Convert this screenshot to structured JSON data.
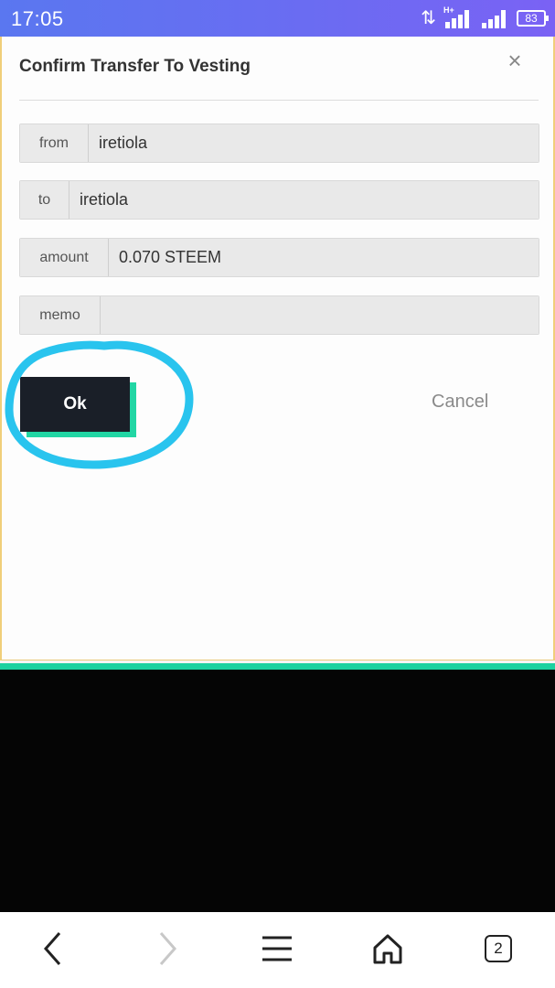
{
  "status_bar": {
    "time": "17:05",
    "network_label": "H+",
    "battery_level": "83",
    "icons": [
      "data-arrows-icon",
      "signal-bars-icon",
      "signal-bars-icon",
      "battery-icon"
    ]
  },
  "dialog": {
    "title": "Confirm Transfer To Vesting",
    "close_icon": "close-icon",
    "fields": [
      {
        "label": "from",
        "value": "iretiola",
        "placeholder": ""
      },
      {
        "label": "to",
        "value": "iretiola",
        "placeholder": ""
      },
      {
        "label": "amount",
        "value": "0.070 STEEM",
        "placeholder": ""
      },
      {
        "label": "memo",
        "value": "",
        "placeholder": ""
      }
    ],
    "ok_label": "Ok",
    "cancel_label": "Cancel"
  },
  "colors": {
    "status_bar": "#6a6cf2",
    "ok_button": "#1a1f28",
    "ok_accent": "#22d6a4",
    "highlight_circle": "#29c4ee",
    "modal_border": "#f0cf7a"
  },
  "nav_bar": {
    "back_icon": "chevron-left-icon",
    "forward_icon": "chevron-right-icon",
    "menu_icon": "menu-icon",
    "home_icon": "home-icon",
    "tabs_count": "2"
  }
}
